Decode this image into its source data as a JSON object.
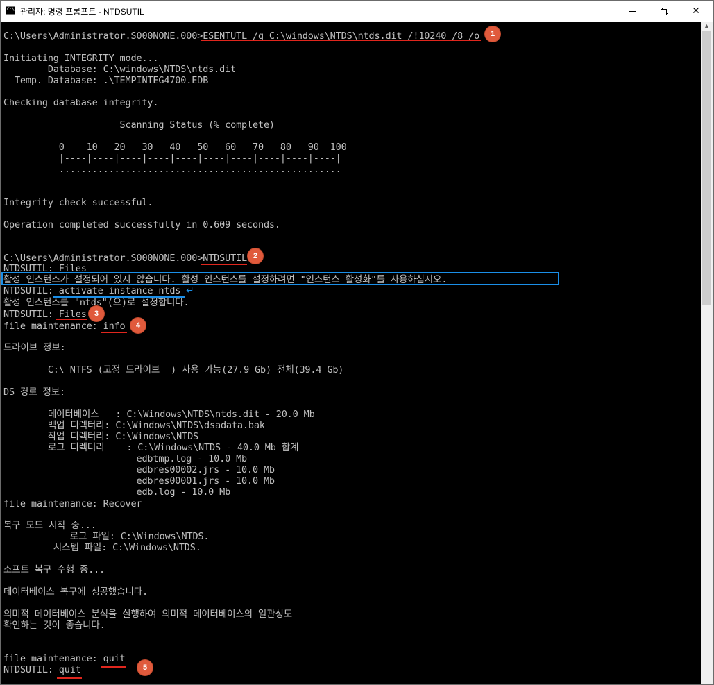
{
  "window": {
    "title": "관리자: 명령 프롬프트 - NTDSUTIL",
    "icon_name": "command-prompt-icon",
    "icon_text": "C:\\",
    "controls": {
      "minimize": "minimize-icon",
      "maximize": "restore-icon",
      "close": "close-icon",
      "close_glyph": "✕"
    }
  },
  "console": {
    "lines": [
      "C:\\Users\\Administrator.S000NONE.000>ESENTUTL /g C:\\windows\\NTDS\\ntds.dit /!10240 /8 /o",
      "",
      "Initiating INTEGRITY mode...",
      "        Database: C:\\windows\\NTDS\\ntds.dit",
      "  Temp. Database: .\\TEMPINTEG4700.EDB",
      "",
      "Checking database integrity.",
      "",
      "                     Scanning Status (% complete)",
      "",
      "          0    10   20   30   40   50   60   70   80   90  100",
      "          |----|----|----|----|----|----|----|----|----|----|",
      "          ...................................................",
      "",
      "",
      "",
      "Integrity check successful.",
      "",
      "Operation completed successfully in 0.609 seconds.",
      "",
      "",
      "C:\\Users\\Administrator.S000NONE.000>NTDSUTIL",
      "NTDSUTIL: Files",
      "활성 인스턴스가 설정되어 있지 않습니다. 활성 인스턴스를 설정하려면 \"인스턴스 활성화\"를 사용하십시오.",
      "NTDSUTIL: activate instance ntds",
      "활성 인스턴스를 \"ntds\"(으)로 설정합니다.",
      "NTDSUTIL: Files",
      "file maintenance: info",
      "",
      "드라이브 정보:",
      "",
      "        C:\\ NTFS (고정 드라이브  ) 사용 가능(27.9 Gb) 전체(39.4 Gb)",
      "",
      "DS 경로 정보:",
      "",
      "        데이터베이스   : C:\\Windows\\NTDS\\ntds.dit - 20.0 Mb",
      "        백업 디렉터리: C:\\Windows\\NTDS\\dsadata.bak",
      "        작업 디렉터리: C:\\Windows\\NTDS",
      "        로그 디렉터리    : C:\\Windows\\NTDS - 40.0 Mb 합계",
      "                        edbtmp.log - 10.0 Mb",
      "                        edbres00002.jrs - 10.0 Mb",
      "                        edbres00001.jrs - 10.0 Mb",
      "                        edb.log - 10.0 Mb",
      "file maintenance: Recover",
      "",
      "복구 모드 시작 중...",
      "            로그 파일: C:\\Windows\\NTDS.",
      "         시스템 파일: C:\\Windows\\NTDS.",
      "",
      "소프트 복구 수행 중...",
      "",
      "데이터베이스 복구에 성공했습니다.",
      "",
      "의미적 데이터베이스 분석을 실행하여 의미적 데이터베이스의 일관성도",
      "확인하는 것이 좋습니다.",
      "",
      "",
      "file maintenance: quit",
      "NTDSUTIL: quit"
    ]
  },
  "annotations": {
    "badges": [
      "1",
      "2",
      "3",
      "4",
      "5"
    ],
    "colors": {
      "underline": "#e0261d",
      "highlight_box": "#1b8fe8",
      "badge": "#e05a3c",
      "console_bg": "#000000",
      "console_text": "#c0c0c0"
    },
    "arrow_glyph": "↵"
  }
}
